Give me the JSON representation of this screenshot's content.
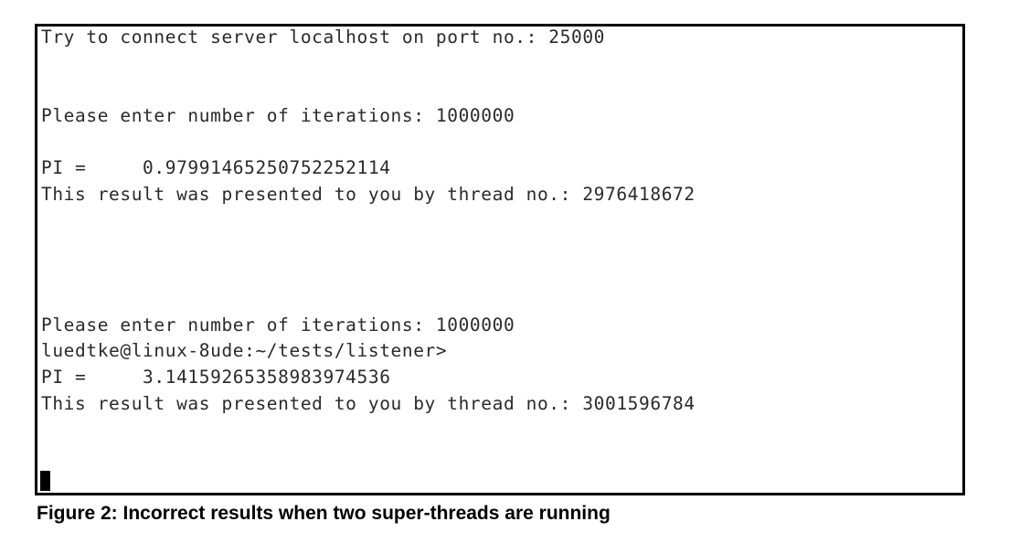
{
  "terminal": {
    "lines": [
      "Try to connect server localhost on port no.: 25000",
      "Please enter number of iterations: 1000000",
      "PI =     0.97991465250752252114",
      "This result was presented to you by thread no.: 2976418672",
      "Please enter number of iterations: 1000000",
      "luedtke@linux-8ude:~/tests/listener>",
      "PI =     3.14159265358983974536",
      "This result was presented to you by thread no.: 3001596784"
    ]
  },
  "caption": "Figure 2: Incorrect results when two super-threads are running"
}
